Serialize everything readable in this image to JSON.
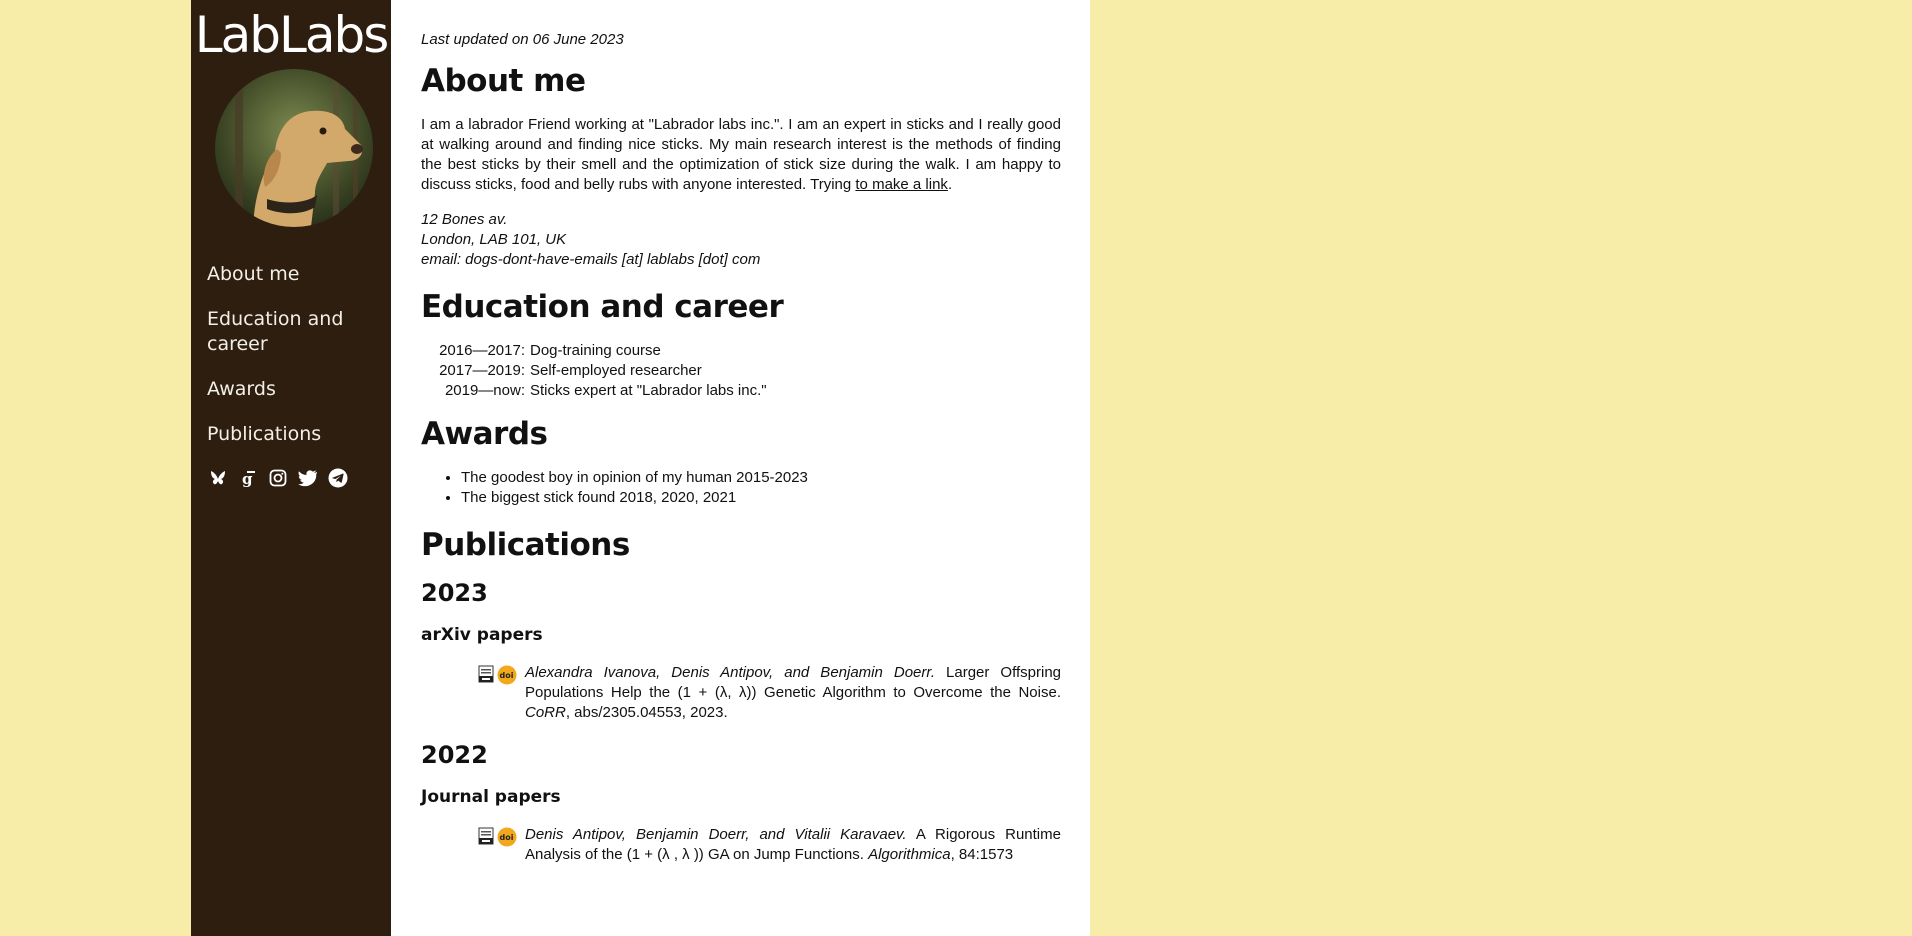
{
  "sidebar": {
    "brand": "LabLabs",
    "nav": [
      {
        "label": "About me"
      },
      {
        "label": "Education and career"
      },
      {
        "label": "Awards"
      },
      {
        "label": "Publications"
      }
    ],
    "social_icons": [
      "bluesky-icon",
      "google-scholar-icon",
      "instagram-icon",
      "twitter-icon",
      "telegram-icon"
    ]
  },
  "content": {
    "last_updated": "Last updated on 06 June 2023",
    "about": {
      "heading": "About me",
      "text_before_link": "I am a labrador Friend working at \"Labrador labs inc.\". I am an expert in sticks and I really good at walking around and finding nice sticks. My main research interest is the methods of finding the best sticks by their smell and the optimization of stick size during the walk. I am happy to discuss sticks, food and belly rubs with anyone interested. Trying ",
      "link_text": "to make a link",
      "text_after_link": ".",
      "address_lines": [
        "12 Bones av.",
        "London, LAB 101, UK",
        "email: dogs-dont-have-emails [at] lablabs [dot] com"
      ]
    },
    "education": {
      "heading": "Education and career",
      "entries": [
        {
          "years": "2016—2017:",
          "text": "Dog-training course"
        },
        {
          "years": "2017—2019:",
          "text": "Self-employed researcher"
        },
        {
          "years": "2019—now:",
          "text": "Sticks expert at \"Labrador labs inc.\""
        }
      ]
    },
    "awards": {
      "heading": "Awards",
      "items": [
        "The goodest boy in opinion of my human 2015-2023",
        "The biggest stick found 2018, 2020, 2021"
      ]
    },
    "publications": {
      "heading": "Publications",
      "years": [
        {
          "year": "2023",
          "category": "arXiv papers",
          "papers": [
            {
              "authors": "Alexandra Ivanova, Denis Antipov, and Benjamin Doerr.",
              "title": " Larger Offspring Populations Help the (1 + (λ, λ)) Genetic Algorithm to Overcome the Noise. ",
              "venue": "CoRR",
              "details": ", abs/2305.04553, 2023."
            }
          ]
        },
        {
          "year": "2022",
          "category": "Journal papers",
          "papers": [
            {
              "authors": "Denis Antipov, Benjamin Doerr, and Vitalii Karavaev.",
              "title": " A Rigorous Runtime Analysis of the (1 + (λ , λ )) GA on Jump Functions. ",
              "venue": "Algorithmica",
              "details": ", 84:1573"
            }
          ]
        }
      ]
    }
  },
  "colors": {
    "background": "#f7eca8",
    "sidebar": "#2d1e10",
    "content": "#ffffff",
    "doi_badge": "#f2a81d"
  }
}
